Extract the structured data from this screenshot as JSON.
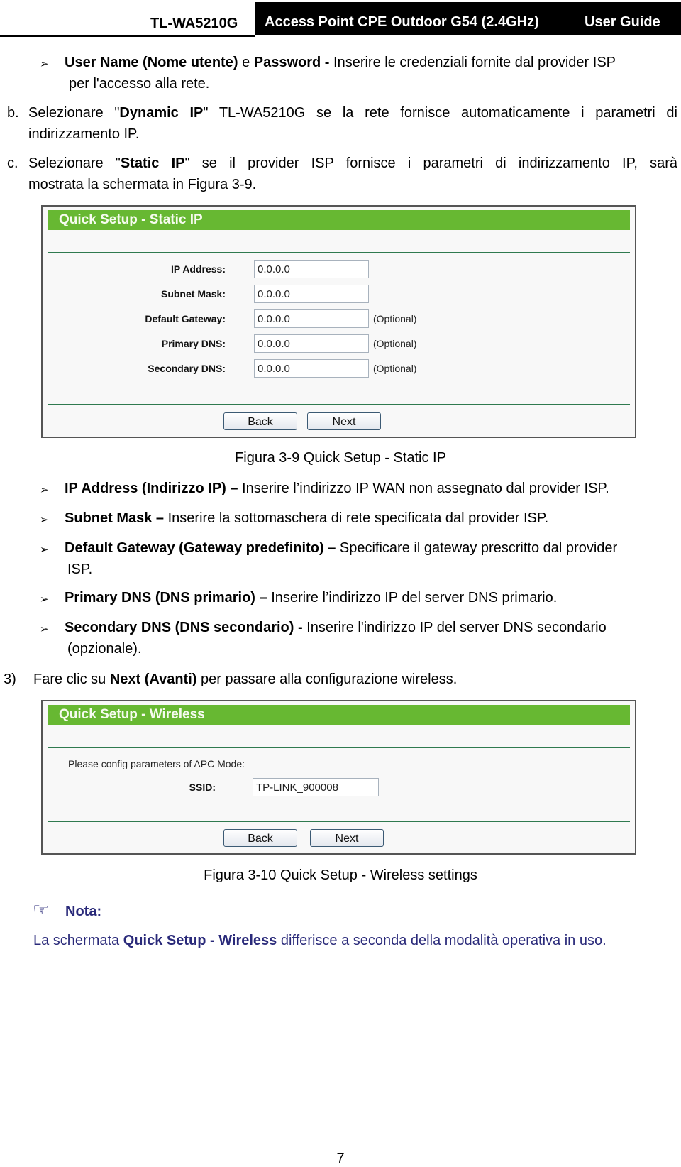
{
  "header": {
    "model": "TL-WA5210G",
    "title": "Access Point CPE Outdoor G54 (2.4GHz)",
    "guide": "User Guide"
  },
  "intro": {
    "bullet_user": {
      "bold1": "User Name (Nome utente)",
      "mid": " e ",
      "bold2": "Password -",
      "text": " Inserire le credenziali fornite dal provider ISP",
      "cont": "per l'accesso alla rete."
    },
    "item_b": {
      "marker": "b.",
      "pre": "Selezionare \"",
      "bold": "Dynamic IP",
      "post": "\" TL-WA5210G se la rete fornisce automaticamente i parametri di",
      "cont": "indirizzamento IP."
    },
    "item_c": {
      "marker": "c.",
      "pre": "Selezionare \"",
      "bold": "Static IP",
      "post": "\" se il provider ISP fornisce i parametri di indirizzamento IP, sarà",
      "cont": "mostrata la schermata in Figura 3-9."
    }
  },
  "figure_static": {
    "title": "Quick Setup - Static IP",
    "fields": [
      {
        "label": "IP Address:",
        "value": "0.0.0.0",
        "optional": ""
      },
      {
        "label": "Subnet Mask:",
        "value": "0.0.0.0",
        "optional": ""
      },
      {
        "label": "Default Gateway:",
        "value": "0.0.0.0",
        "optional": "(Optional)"
      },
      {
        "label": "Primary DNS:",
        "value": "0.0.0.0",
        "optional": "(Optional)"
      },
      {
        "label": "Secondary DNS:",
        "value": "0.0.0.0",
        "optional": "(Optional)"
      }
    ],
    "back": "Back",
    "next": "Next",
    "caption": "Figura 3-9 Quick Setup - Static IP"
  },
  "descriptions": [
    {
      "bold": "IP Address (Indirizzo IP) –",
      "text": " Inserire l’indirizzo IP WAN non assegnato dal provider ISP.",
      "cont": ""
    },
    {
      "bold": "Subnet Mask –",
      "text": " Inserire la sottomaschera di rete specificata dal provider ISP.",
      "cont": ""
    },
    {
      "bold": "Default Gateway (Gateway predefinito) –",
      "text": " Specificare il gateway prescritto dal provider",
      "cont": "ISP."
    },
    {
      "bold": "Primary DNS (DNS primario) –",
      "text": " Inserire l’indirizzo IP del server DNS primario.",
      "cont": ""
    },
    {
      "bold": "Secondary DNS (DNS secondario) -",
      "text": " Inserire l'indirizzo IP del server DNS secondario",
      "cont": "(opzionale)."
    }
  ],
  "step3": {
    "marker": "3)",
    "pre": "Fare clic su ",
    "bold": "Next (Avanti)",
    "post": " per passare alla configurazione wireless."
  },
  "figure_wireless": {
    "title": "Quick Setup - Wireless",
    "intro": "Please config parameters of APC Mode:",
    "ssid_label": "SSID:",
    "ssid_value": "TP-LINK_900008",
    "back": "Back",
    "next": "Next",
    "caption": "Figura 3-10 Quick Setup - Wireless settings"
  },
  "note": {
    "icon": "pointing-hand-icon",
    "title": "Nota:",
    "pre": "La schermata ",
    "bold": "Quick Setup - Wireless",
    "post": " differisce a seconda della modalità operativa in uso."
  },
  "page_number": "7",
  "colors": {
    "accent_green": "#67b832",
    "note_blue": "#2a2a7a",
    "rule_green": "#2f7a4f"
  }
}
